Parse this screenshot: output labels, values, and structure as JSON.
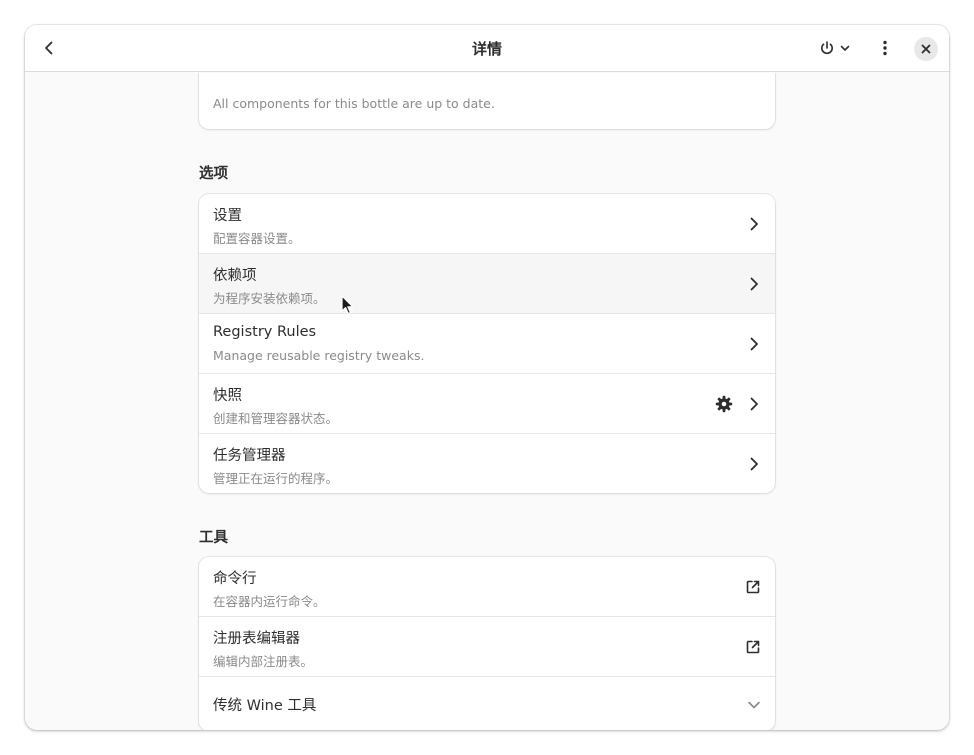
{
  "header": {
    "title": "详情"
  },
  "top_card": {
    "subtitle": "All components for this bottle are up to date."
  },
  "options": {
    "section_title": "选项",
    "items": [
      {
        "title": "设置",
        "subtitle": "配置容器设置。"
      },
      {
        "title": "依赖项",
        "subtitle": "为程序安装依赖项。"
      },
      {
        "title": "Registry Rules",
        "subtitle": "Manage reusable registry tweaks."
      },
      {
        "title": "快照",
        "subtitle": "创建和管理容器状态。"
      },
      {
        "title": "任务管理器",
        "subtitle": "管理正在运行的程序。"
      }
    ]
  },
  "tools": {
    "section_title": "工具",
    "items": [
      {
        "title": "命令行",
        "subtitle": "在容器内运行命令。"
      },
      {
        "title": "注册表编辑器",
        "subtitle": "编辑内部注册表。"
      },
      {
        "title": "传统 Wine 工具"
      }
    ]
  },
  "colors": {
    "text": "#2e2e2e",
    "subtext": "#8a8a8a",
    "card": "#ffffff",
    "background": "#fafafa"
  },
  "icons": {
    "back": "chevron-left-icon",
    "power": "power-icon",
    "menu": "vertical-dots-menu-icon",
    "close": "close-icon",
    "row_nav": "chevron-right-icon",
    "snapshot_settings": "gear-icon",
    "external": "external-link-icon",
    "expand": "chevron-down-icon"
  }
}
